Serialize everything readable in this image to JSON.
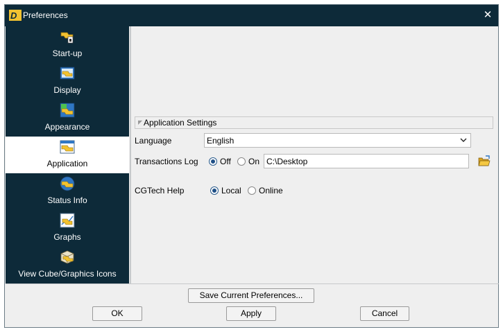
{
  "window": {
    "title": "Preferences",
    "app_icon": "app-logo-icon",
    "close_icon": "close-icon"
  },
  "sidebar": {
    "items": [
      {
        "label": "Start-up",
        "icon": "startup-icon",
        "selected": false
      },
      {
        "label": "Display",
        "icon": "display-icon",
        "selected": false
      },
      {
        "label": "Appearance",
        "icon": "appearance-icon",
        "selected": false
      },
      {
        "label": "Application",
        "icon": "application-icon",
        "selected": true
      },
      {
        "label": "Status Info",
        "icon": "status-info-icon",
        "selected": false
      },
      {
        "label": "Graphs",
        "icon": "graphs-icon",
        "selected": false
      },
      {
        "label": "View Cube/Graphics Icons",
        "icon": "view-cube-icon",
        "selected": false
      }
    ]
  },
  "settings": {
    "group_title": "Application Settings",
    "language_label": "Language",
    "language_value": "English",
    "transactions_label": "Transactions Log",
    "off_label": "Off",
    "on_label": "On",
    "transactions_selected": "Off",
    "path_value": "C:\\Desktop",
    "help_label": "CGTech Help",
    "local_label": "Local",
    "online_label": "Online",
    "help_selected": "Local"
  },
  "buttons": {
    "save_prefs": "Save Current Preferences...",
    "ok": "OK",
    "apply": "Apply",
    "cancel": "Cancel"
  },
  "colors": {
    "titlebar": "#0d2a39",
    "sidebar": "#0d2a39",
    "selected_item": "#ffffff",
    "background": "#efefef",
    "icon_yellow": "#f2c230"
  }
}
